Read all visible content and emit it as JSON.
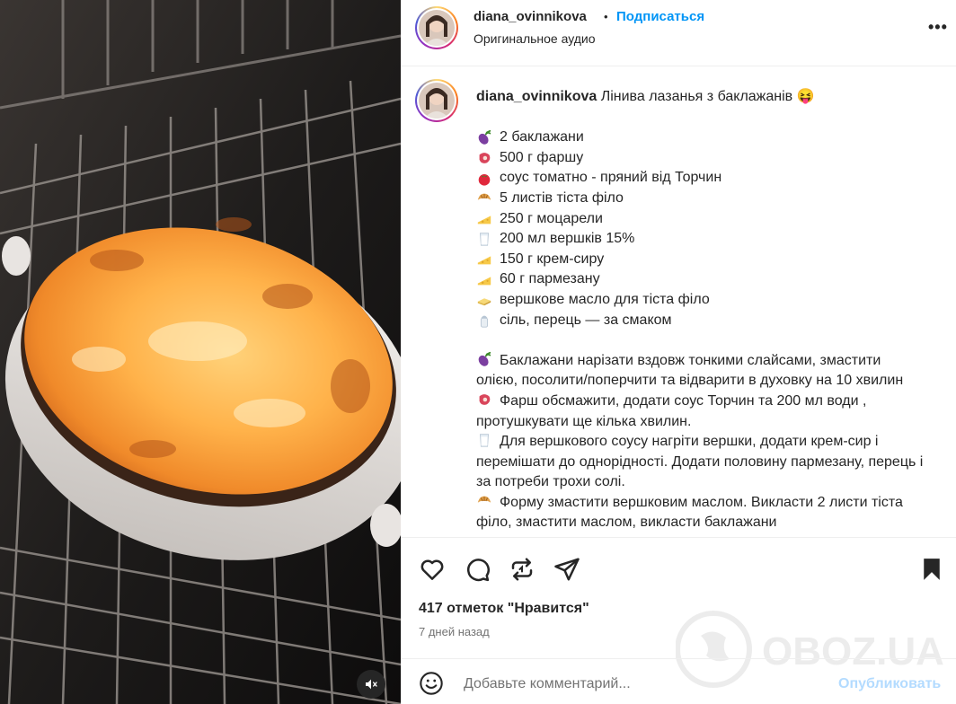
{
  "post": {
    "username": "diana_ovinnikova",
    "separator": "•",
    "follow_label": "Подписаться",
    "audio_label": "Оригинальное аудио",
    "more_label": "•••"
  },
  "caption": {
    "username": "diana_ovinnikova",
    "title": "Лінива лазанья з баклажанів 😝",
    "ingredients": [
      {
        "icon": "eggplant-icon",
        "text": "2 баклажани"
      },
      {
        "icon": "meat-icon",
        "text": "500 г фаршу"
      },
      {
        "icon": "tomato-icon",
        "text": "соус томатно - пряний від Торчин"
      },
      {
        "icon": "croissant-icon",
        "text": "5 листів тіста філо"
      },
      {
        "icon": "cheese-icon",
        "text": "250 г моцарели"
      },
      {
        "icon": "glass-of-milk-icon",
        "text": "200 мл вершків 15%"
      },
      {
        "icon": "cheese-icon",
        "text": "150 г крем-сиру"
      },
      {
        "icon": "cheese-icon",
        "text": "60 г пармезану"
      },
      {
        "icon": "butter-icon",
        "text": "вершкове масло для тіста філо"
      },
      {
        "icon": "salt-shaker-icon",
        "text": "сіль, перець — за смаком"
      }
    ],
    "steps": [
      {
        "icon": "eggplant-icon",
        "text": "Баклажани нарізати вздовж тонкими слайсами, змастити олією, посолити/поперчити та відварити в духовку на 10 хвилин"
      },
      {
        "icon": "meat-icon",
        "text": "Фарш обсмажити, додати соус Торчин та 200 мл води , протушкувати ще кілька хвилин."
      },
      {
        "icon": "glass-of-milk-icon",
        "text": "Для вершкового соусу нагріти вершки, додати крем-сир і перемішати до однорідності. Додати половину пармезану, перець і за потреби трохи солі."
      },
      {
        "icon": "croissant-icon",
        "text": "Форму змастити вершковим маслом. Викласти 2 листи тіста філо, змастити маслом, викласти баклажани"
      }
    ]
  },
  "engagement": {
    "likes": "417 отметок \"Нравится\"",
    "time_ago": "7 дней назад"
  },
  "comment": {
    "placeholder": "Добавьте комментарий...",
    "publish_label": "Опубликовать"
  },
  "watermark": {
    "text": "OBOZ.UA"
  },
  "colors": {
    "accent": "#0095f6",
    "publish_disabled": "#b3dbff",
    "muted": "#737373",
    "text": "#262626"
  }
}
